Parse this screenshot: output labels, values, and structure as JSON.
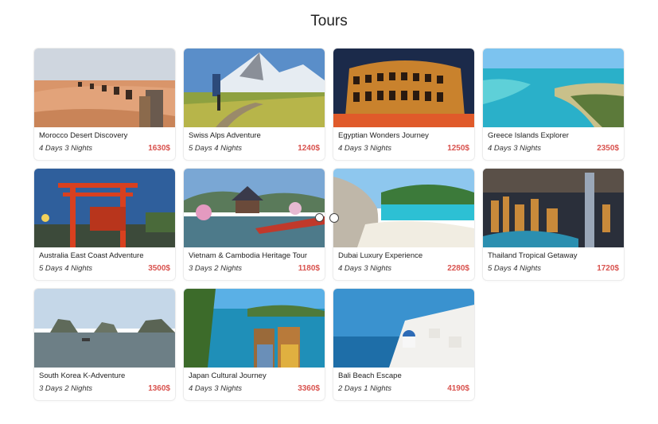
{
  "header": {
    "title": "Tours"
  },
  "currency_suffix": "$",
  "tours": [
    {
      "name": "Morocco Desert Discovery",
      "duration": "4 Days 3 Nights",
      "price": "1630$",
      "image": "desert-camels"
    },
    {
      "name": "Swiss Alps Adventure",
      "duration": "5 Days 4 Nights",
      "price": "1240$",
      "image": "alps-hiker"
    },
    {
      "name": "Egyptian Wonders Journey",
      "duration": "4 Days 3 Nights",
      "price": "1250$",
      "image": "colosseum-night"
    },
    {
      "name": "Greece Islands Explorer",
      "duration": "4 Days 3 Nights",
      "price": "2350$",
      "image": "island-coast"
    },
    {
      "name": "Australia East Coast Adventure",
      "duration": "5 Days 4 Nights",
      "price": "3500$",
      "image": "torii-gate"
    },
    {
      "name": "Vietnam & Cambodia Heritage Tour",
      "duration": "3 Days 2 Nights",
      "price": "1180$",
      "image": "korean-pavilion"
    },
    {
      "name": "Dubai Luxury Experience",
      "duration": "4 Days 3 Nights",
      "price": "2280$",
      "image": "rocky-beach"
    },
    {
      "name": "Thailand Tropical Getaway",
      "duration": "5 Days 4 Nights",
      "price": "1720$",
      "image": "dubai-skyline"
    },
    {
      "name": "South Korea K-Adventure",
      "duration": "3 Days 2 Nights",
      "price": "1360$",
      "image": "limestone-bay"
    },
    {
      "name": "Japan Cultural Journey",
      "duration": "4 Days 3 Nights",
      "price": "3360$",
      "image": "two-women-coast"
    },
    {
      "name": "Bali Beach Escape",
      "duration": "2 Days 1 Nights",
      "price": "4190$",
      "image": "santorini"
    }
  ],
  "colors": {
    "price": "#d9534f",
    "title": "#222222"
  }
}
